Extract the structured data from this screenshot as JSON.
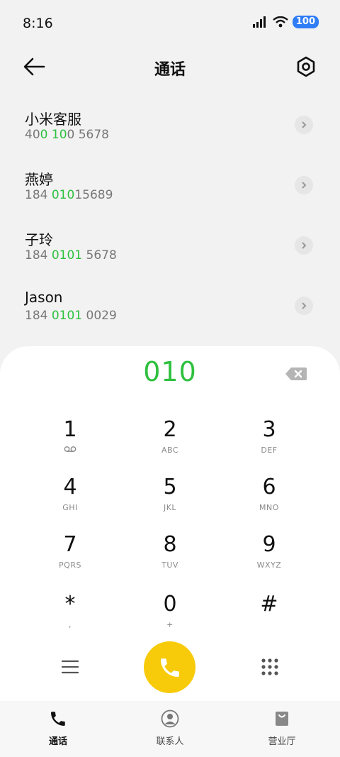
{
  "status": {
    "time": "8:16",
    "battery": "100"
  },
  "header": {
    "title": "通话"
  },
  "contacts": [
    {
      "name": "小米客服",
      "number_parts": [
        "40",
        "0",
        " ",
        "10",
        "0 5678"
      ]
    },
    {
      "name": "燕婷",
      "number_parts": [
        "184 ",
        "010",
        "15689"
      ]
    },
    {
      "name": "子玲",
      "number_parts": [
        "184 ",
        "0101",
        " 5678"
      ]
    },
    {
      "name": "Jason",
      "number_parts": [
        "184 ",
        "0101",
        " 0029"
      ]
    }
  ],
  "dialpad": {
    "input": "010",
    "keys": [
      {
        "digit": "1",
        "letters": ""
      },
      {
        "digit": "2",
        "letters": "ABC"
      },
      {
        "digit": "3",
        "letters": "DEF"
      },
      {
        "digit": "4",
        "letters": "GHI"
      },
      {
        "digit": "5",
        "letters": "JKL"
      },
      {
        "digit": "6",
        "letters": "MNO"
      },
      {
        "digit": "7",
        "letters": "PQRS"
      },
      {
        "digit": "8",
        "letters": "TUV"
      },
      {
        "digit": "9",
        "letters": "WXYZ"
      },
      {
        "digit": "*",
        "letters": ","
      },
      {
        "digit": "0",
        "letters": "+"
      },
      {
        "digit": "#",
        "letters": ""
      }
    ]
  },
  "nav": [
    {
      "label": "通话",
      "icon": "phone-icon",
      "active": true
    },
    {
      "label": "联系人",
      "icon": "person-icon",
      "active": false
    },
    {
      "label": "营业厅",
      "icon": "bag-icon",
      "active": false
    }
  ],
  "colors": {
    "highlight": "#2ec03e",
    "call_button": "#f7cb0a",
    "battery": "#2f7df6"
  }
}
